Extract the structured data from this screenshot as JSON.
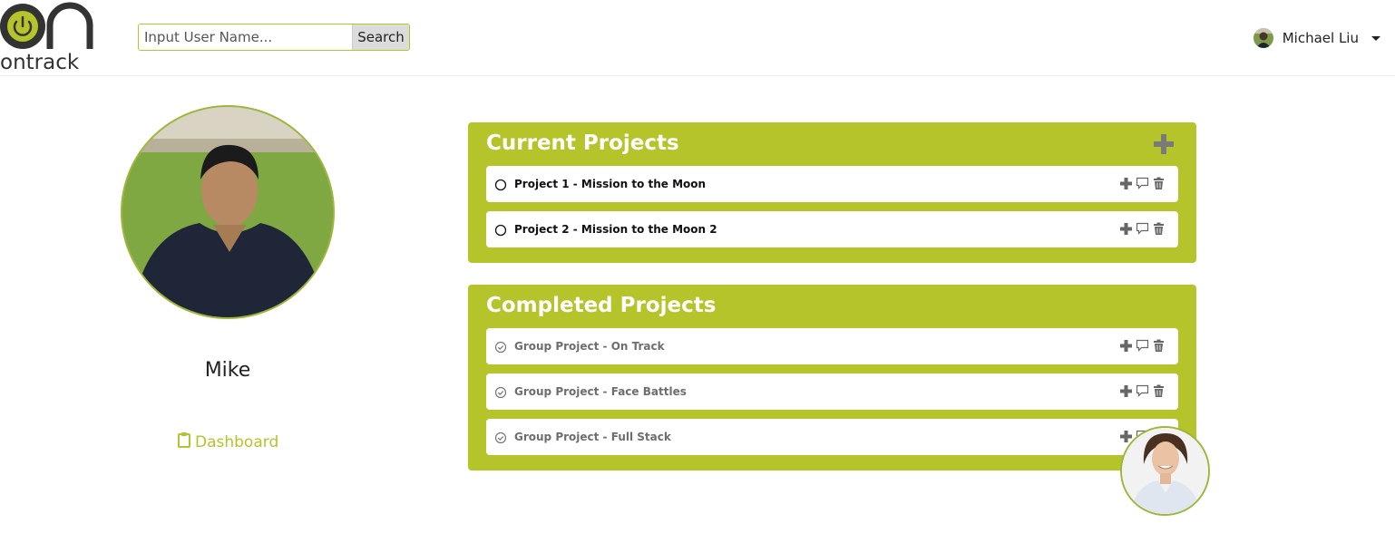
{
  "brand": {
    "logo_text": "ontrack",
    "accent_color": "#b5c42a"
  },
  "search": {
    "placeholder": "Input User Name...",
    "value": "",
    "button_label": "Search"
  },
  "user_menu": {
    "name": "Michael Liu"
  },
  "profile": {
    "name": "Mike",
    "dashboard_label": "Dashboard"
  },
  "current_projects": {
    "title": "Current Projects",
    "items": [
      {
        "label": "Project 1 - Mission to the Moon"
      },
      {
        "label": "Project 2 - Mission to the Moon 2"
      }
    ]
  },
  "completed_projects": {
    "title": "Completed Projects",
    "items": [
      {
        "label": "Group Project - On Track"
      },
      {
        "label": "Group Project - Face Battles"
      },
      {
        "label": "Group Project - Full Stack"
      }
    ]
  },
  "icons": {
    "add": "plus-icon",
    "comment": "comment-icon",
    "delete": "trash-icon",
    "incomplete": "circle-icon",
    "complete": "check-circle-icon",
    "dashboard": "clipboard-icon"
  }
}
